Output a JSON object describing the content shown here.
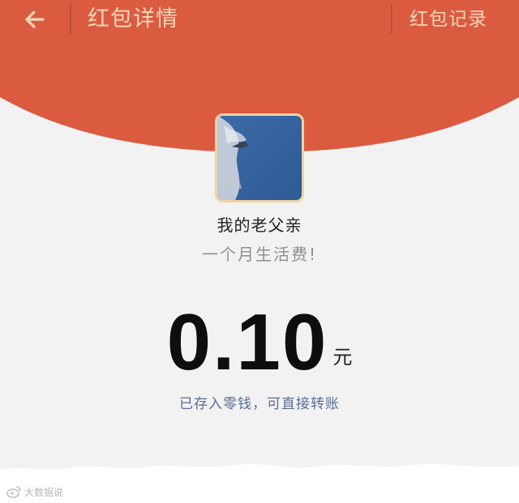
{
  "header": {
    "title": "红包详情",
    "records_link": "红包记录",
    "back_icon": "back-arrow-icon",
    "accent_color": "#db5b41",
    "text_color": "#f6d6b8"
  },
  "packet": {
    "sender": "我的老父亲",
    "blessing": "一个月生活费!",
    "amount": "0.10",
    "currency": "元",
    "note": "已存入零钱，可直接转账"
  },
  "watermark": {
    "text": "大数据说",
    "icon": "weibo-logo-icon"
  }
}
